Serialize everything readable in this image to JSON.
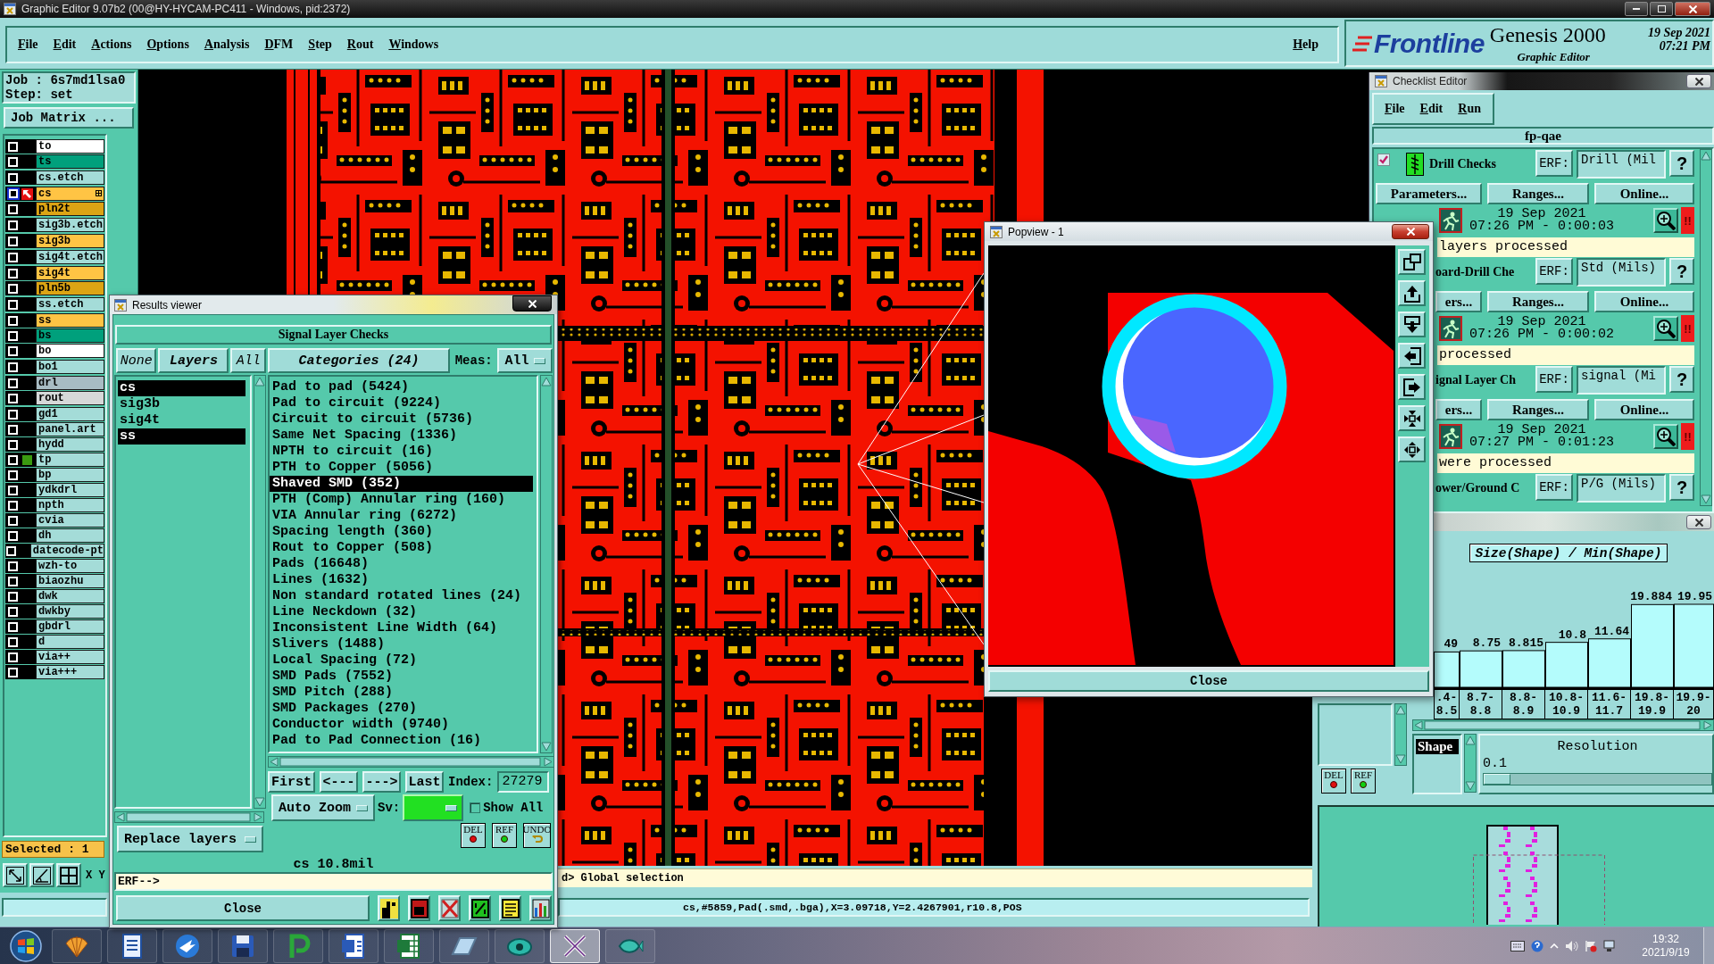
{
  "window": {
    "title": "Graphic Editor 9.07b2 (00@HY-HYCAM-PC411 - Windows, pid:2372)"
  },
  "menu": [
    "File",
    "Edit",
    "Actions",
    "Options",
    "Analysis",
    "DFM",
    "Step",
    "Rout",
    "Windows"
  ],
  "help_menu": "Help",
  "brand": {
    "logo": "Frontline",
    "product": "Genesis 2000",
    "subtitle": "Graphic Editor",
    "date": "19 Sep 2021",
    "time": "07:21 PM"
  },
  "job_panel": {
    "job": "Job : 6s7md1lsa0",
    "step": "Step: set",
    "matrix_button": "Job Matrix ...",
    "layer_groups": [
      {
        "layers": [
          {
            "name": "to",
            "color": "#ffffff",
            "work": false,
            "displayed": false
          },
          {
            "name": "ts",
            "color": "#00a07c",
            "work": false,
            "displayed": false
          }
        ]
      },
      {
        "layers": [
          {
            "name": "cs.etch",
            "color": "#a4dcd8",
            "work": false,
            "displayed": false
          }
        ]
      },
      {
        "layers": [
          {
            "name": "cs",
            "color": "#ffc444",
            "work": true,
            "displayed": false
          },
          {
            "name": "pln2t",
            "color": "#dca414",
            "work": false,
            "displayed": false
          }
        ]
      },
      {
        "layers": [
          {
            "name": "sig3b.etch",
            "color": "#a4dcd8",
            "work": false,
            "displayed": false
          }
        ]
      },
      {
        "layers": [
          {
            "name": "sig3b",
            "color": "#ffc444",
            "work": false,
            "displayed": false
          }
        ]
      },
      {
        "layers": [
          {
            "name": "sig4t.etch",
            "color": "#a4dcd8",
            "work": false,
            "displayed": false
          }
        ]
      },
      {
        "layers": [
          {
            "name": "sig4t",
            "color": "#ffc444",
            "work": false,
            "displayed": false
          },
          {
            "name": "pln5b",
            "color": "#dca414",
            "work": false,
            "displayed": false
          }
        ]
      },
      {
        "layers": [
          {
            "name": "ss.etch",
            "color": "#a4dcd8",
            "work": false,
            "displayed": false
          }
        ]
      },
      {
        "layers": [
          {
            "name": "ss",
            "color": "#ffc444",
            "work": false,
            "displayed": false
          },
          {
            "name": "bs",
            "color": "#00a07c",
            "work": false,
            "displayed": false
          },
          {
            "name": "bo",
            "color": "#ffffff",
            "work": false,
            "displayed": false
          }
        ]
      },
      {
        "layers": [
          {
            "name": "bo1",
            "color": "#a4dcd8",
            "work": false,
            "displayed": false
          }
        ]
      },
      {
        "layers": [
          {
            "name": "drl",
            "color": "#a8bcc4",
            "work": false,
            "displayed": false
          },
          {
            "name": "rout",
            "color": "#d6d8d8",
            "work": false,
            "displayed": false
          }
        ]
      },
      {
        "layers": [
          {
            "name": "gd1",
            "color": "#a4dcd8",
            "work": false,
            "displayed": false
          },
          {
            "name": "panel.art",
            "color": "#a4dcd8",
            "work": false,
            "displayed": false
          },
          {
            "name": "hydd",
            "color": "#a4dcd8",
            "work": false,
            "displayed": false
          },
          {
            "name": "tp",
            "color": "#a4dcd8",
            "work": false,
            "displayed": true
          },
          {
            "name": "bp",
            "color": "#a4dcd8",
            "work": false,
            "displayed": false
          },
          {
            "name": "ydkdrl",
            "color": "#a4dcd8",
            "work": false,
            "displayed": false
          },
          {
            "name": "npth",
            "color": "#a4dcd8",
            "work": false,
            "displayed": false
          },
          {
            "name": "cvia",
            "color": "#a4dcd8",
            "work": false,
            "displayed": false
          },
          {
            "name": "dh",
            "color": "#a4dcd8",
            "work": false,
            "displayed": false
          },
          {
            "name": "datecode-pt",
            "color": "#a4dcd8",
            "work": false,
            "displayed": false
          },
          {
            "name": "wzh-to",
            "color": "#a4dcd8",
            "work": false,
            "displayed": false
          },
          {
            "name": "biaozhu",
            "color": "#a4dcd8",
            "work": false,
            "displayed": false
          },
          {
            "name": "dwk",
            "color": "#a4dcd8",
            "work": false,
            "displayed": false
          },
          {
            "name": "dwkby",
            "color": "#a4dcd8",
            "work": false,
            "displayed": false
          },
          {
            "name": "gbdrl",
            "color": "#a4dcd8",
            "work": false,
            "displayed": false
          },
          {
            "name": "d",
            "color": "#a4dcd8",
            "work": false,
            "displayed": false
          },
          {
            "name": "via++",
            "color": "#a4dcd8",
            "work": false,
            "displayed": false
          },
          {
            "name": "via+++",
            "color": "#a4dcd8",
            "work": false,
            "displayed": false
          }
        ]
      }
    ],
    "selected_count": "Selected : 1",
    "coords_label": "X Y"
  },
  "command_line": "d> Global selection",
  "status_bar": "cs,#5859,Pad(.smd,.bga),X=3.09718,Y=2.4267901,r10.8,POS",
  "results_viewer": {
    "title": "Results viewer",
    "heading": "Signal Layer Checks",
    "layer_buttons": [
      "None",
      "Layers",
      "All"
    ],
    "layers": [
      {
        "name": "cs",
        "selected": true
      },
      {
        "name": "sig3b",
        "selected": false
      },
      {
        "name": "sig4t",
        "selected": false
      },
      {
        "name": "ss",
        "selected": true
      }
    ],
    "categories_button": "Categories (24)",
    "meas_label": "Meas:",
    "meas_value": "All",
    "categories": [
      {
        "label": "Pad to pad (5424)",
        "selected": false
      },
      {
        "label": "Pad to circuit (9224)",
        "selected": false
      },
      {
        "label": "Circuit to circuit (5736)",
        "selected": false
      },
      {
        "label": "Same Net Spacing (1336)",
        "selected": false
      },
      {
        "label": "NPTH to circuit (16)",
        "selected": false
      },
      {
        "label": "PTH to Copper (5056)",
        "selected": false
      },
      {
        "label": "Shaved SMD (352)",
        "selected": true
      },
      {
        "label": "PTH (Comp) Annular ring (160)",
        "selected": false
      },
      {
        "label": "VIA Annular ring (6272)",
        "selected": false
      },
      {
        "label": "Spacing length (360)",
        "selected": false
      },
      {
        "label": "Rout to Copper (508)",
        "selected": false
      },
      {
        "label": "Pads (16648)",
        "selected": false
      },
      {
        "label": "Lines (1632)",
        "selected": false
      },
      {
        "label": "Non standard rotated lines (24)",
        "selected": false
      },
      {
        "label": "Line Neckdown (32)",
        "selected": false
      },
      {
        "label": "Inconsistent Line Width (64)",
        "selected": false
      },
      {
        "label": "Slivers (1488)",
        "selected": false
      },
      {
        "label": "Local Spacing (72)",
        "selected": false
      },
      {
        "label": "SMD Pads (7552)",
        "selected": false
      },
      {
        "label": "SMD Pitch (288)",
        "selected": false
      },
      {
        "label": "SMD Packages (270)",
        "selected": false
      },
      {
        "label": "Conductor width (9740)",
        "selected": false
      },
      {
        "label": "Pad to Pad Connection (16)",
        "selected": false
      }
    ],
    "nav_buttons": [
      "First",
      "<---",
      "--->",
      "Last"
    ],
    "index_label": "Index:",
    "index_value": "27279",
    "zoom_mode": "Auto Zoom",
    "sv_label": "Sv:",
    "show_all": {
      "label": "Show All",
      "checked": false
    },
    "action_icons": [
      "DEL",
      "REF",
      "UNDO"
    ],
    "layer_mode": "Replace layers",
    "measurement": "cs 10.8mil",
    "erf_prompt": "ERF-->",
    "close_button": "Close"
  },
  "popview": {
    "title": "Popview - 1",
    "close_button": "Close"
  },
  "checklist_editor": {
    "title": "Checklist Editor",
    "menu": [
      "File",
      "Edit",
      "Run"
    ],
    "checklist": "fp-qae",
    "checks": [
      {
        "kind": "full",
        "checked": true,
        "title": "Drill Checks",
        "erf_label": "ERF:",
        "erf": "Drill (Mil",
        "help": "?",
        "buttons": [
          "Parameters...",
          "Ranges...",
          "Online..."
        ],
        "date": "19 Sep 2021",
        "duration": "07:26 PM - 0:00:03",
        "alert": "!!",
        "message": "layers processed"
      },
      {
        "kind": "clipped",
        "title": "oard-Drill Che",
        "erf_label": "ERF:",
        "erf": "Std (Mils)",
        "help": "?",
        "buttons": [
          "ers...",
          "Ranges...",
          "Online..."
        ],
        "date": "19 Sep 2021",
        "duration": "07:26 PM - 0:00:02",
        "alert": "!!",
        "message": "processed"
      },
      {
        "kind": "clipped",
        "title": "ignal Layer Ch",
        "erf_label": "ERF:",
        "erf": "signal (Mi",
        "help": "?",
        "buttons": [
          "ers...",
          "Ranges...",
          "Online..."
        ],
        "date": "19 Sep 2021",
        "duration": "07:27 PM - 0:01:23",
        "alert": "!!",
        "message": "were processed"
      },
      {
        "kind": "clipped",
        "title": "ower/Ground C",
        "erf_label": "ERF:",
        "erf": "P/G (Mils)",
        "help": "?"
      }
    ]
  },
  "histogram": {
    "chart_data": {
      "type": "bar",
      "title": "Size(Shape) / Min(Shape)",
      "categories": [
        ".4-\n8.5",
        "8.7-\n8.8",
        "8.8-\n8.9",
        "10.8-\n10.9",
        "11.6-\n11.7",
        "19.8-\n19.9",
        "19.9-\n20"
      ],
      "values": [
        8.49,
        8.75,
        8.815,
        10.8,
        11.64,
        19.884,
        19.95
      ],
      "value_labels": [
        null,
        "8.75",
        "8.815",
        "10.8",
        "11.64",
        "19.884",
        "19.95"
      ]
    },
    "clipped_value_label": "49",
    "list_items": [
      {
        "label": "Shape",
        "selected": true
      }
    ],
    "resolution": {
      "label": "Resolution",
      "value": "0.1",
      "level": 0
    },
    "action_icons": [
      "DEL",
      "REF"
    ]
  },
  "taskbar": {
    "apps": [
      {
        "selected": false
      },
      {
        "selected": false
      },
      {
        "selected": false
      },
      {
        "selected": false
      },
      {
        "selected": false
      },
      {
        "selected": false
      },
      {
        "selected": false
      },
      {
        "selected": false
      },
      {
        "selected": false
      },
      {
        "selected": true
      },
      {
        "selected": false
      }
    ],
    "time": "19:32",
    "date": "2021/9/19"
  }
}
